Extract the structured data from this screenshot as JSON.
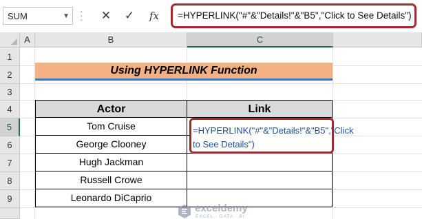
{
  "formula_bar": {
    "name_box": "SUM",
    "name_box_arrow_icon": "chevron-down-icon",
    "cancel_icon": "close-icon",
    "enter_icon": "check-icon",
    "fx_label": "fx",
    "formula": "=HYPERLINK(\"#\"&\"Details!\"&\"B5\",\"Click to See Details\")"
  },
  "columns": [
    "A",
    "B",
    "C"
  ],
  "selected_column": "C",
  "rows": [
    "1",
    "2",
    "3",
    "4",
    "5",
    "6",
    "7",
    "8",
    "9"
  ],
  "selected_row": "5",
  "title": "Using HYPERLINK Function",
  "table": {
    "headers": [
      "Actor",
      "Link"
    ],
    "actors": [
      "Tom Cruise",
      "George Clooney",
      "Hugh Jackman",
      "Russell Crowe",
      "Leonardo DiCaprio"
    ],
    "editing_formula": "=HYPERLINK(\"#\"&\"Details!\"&\"B5\",\"Click to See Details\")"
  },
  "watermark": {
    "name": "exceldemy",
    "tagline": "EXCEL · DATA · BI"
  },
  "colors": {
    "title_fill": "#f4b183",
    "title_underline": "#4472c4",
    "highlight_border": "#a02b2b",
    "formula_text": "#1f4e9c",
    "header_fill": "#d9d9d9"
  }
}
